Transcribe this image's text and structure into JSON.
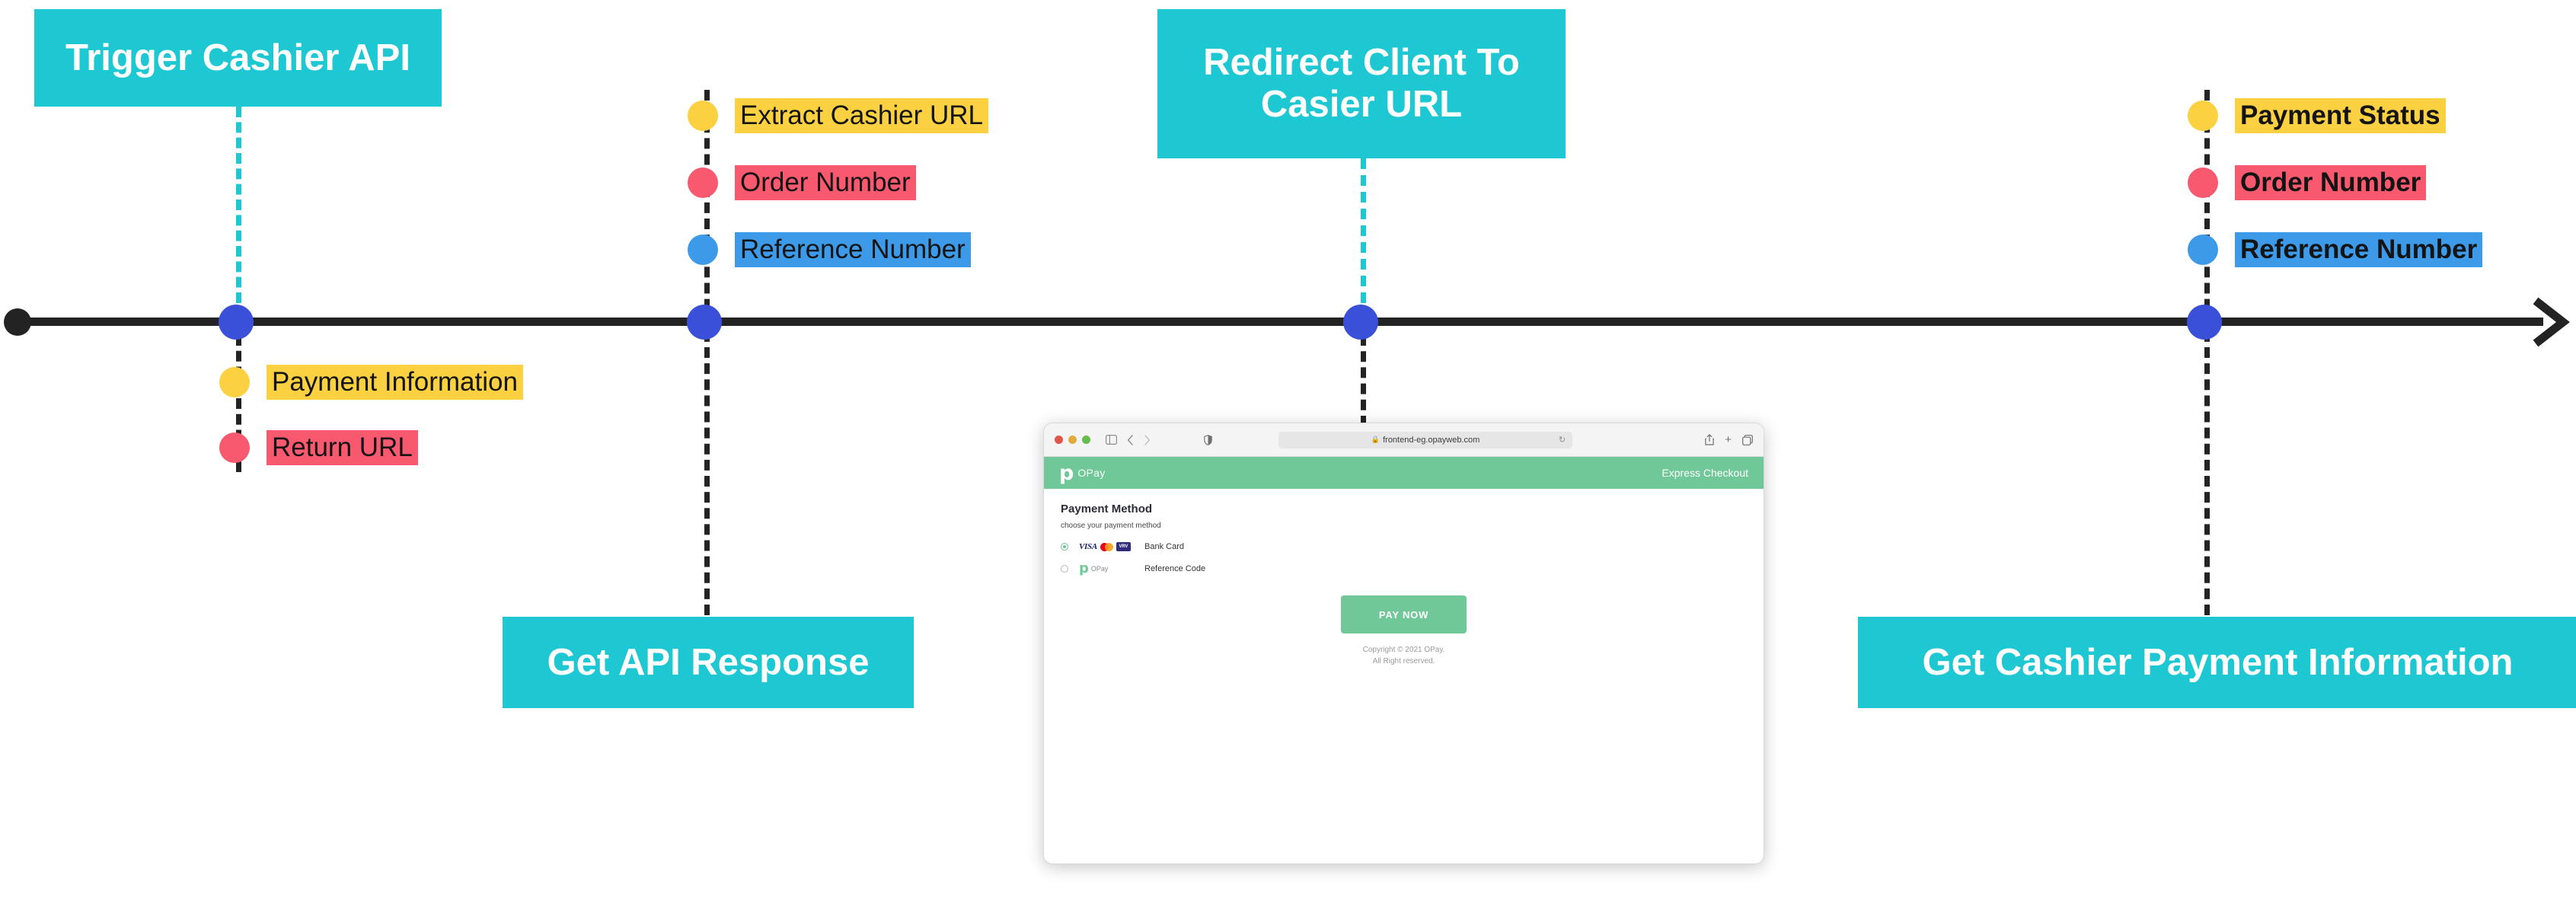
{
  "diagram": {
    "title": "OPay Cashier API integration timeline",
    "colors": {
      "teal": "#1ec8d3",
      "node_blue": "#3b50d8",
      "axis_black": "#232323",
      "yellow": "#fbd041",
      "pink": "#f8596f",
      "blue": "#3d9ae8",
      "opay_green": "#70c898"
    },
    "stages": [
      {
        "id": "trigger",
        "label": "Trigger Cashier API"
      },
      {
        "id": "api_response",
        "label": "Get API Response"
      },
      {
        "id": "redirect",
        "label": "Redirect Client To Casier URL"
      },
      {
        "id": "cashier_info",
        "label": "Get Cashier Payment Information"
      }
    ],
    "label_clusters": [
      {
        "id": "request-fields",
        "position": "below",
        "items": [
          {
            "text": "Payment Information",
            "color": "yellow",
            "bold": false
          },
          {
            "text": "Return URL",
            "color": "pink",
            "bold": false
          }
        ]
      },
      {
        "id": "response-fields",
        "position": "above",
        "items": [
          {
            "text": "Extract Cashier URL",
            "color": "yellow",
            "bold": false
          },
          {
            "text": "Order Number",
            "color": "pink",
            "bold": false
          },
          {
            "text": "Reference Number",
            "color": "blue",
            "bold": false
          }
        ]
      },
      {
        "id": "status-fields",
        "position": "above",
        "items": [
          {
            "text": "Payment Status",
            "color": "yellow",
            "bold": true
          },
          {
            "text": "Order Number",
            "color": "pink",
            "bold": true
          },
          {
            "text": "Reference Number",
            "color": "blue",
            "bold": true
          }
        ]
      }
    ]
  },
  "browser": {
    "url": "frontend-eg.opayweb.com",
    "lock_icon": "lock-icon",
    "reload_icon": "reload-icon",
    "traffic_lights": [
      "close-red",
      "minimize-yellow",
      "zoom-green"
    ],
    "toolbar_icons": [
      "sidebar-icon",
      "back-chevron-icon",
      "forward-chevron-icon",
      "shield-icon",
      "share-icon",
      "new-tab-icon",
      "tab-overview-icon"
    ],
    "page": {
      "brand_mark": "p",
      "brand_name": "OPay",
      "header_right": "Express Checkout",
      "section_title": "Payment Method",
      "section_subtitle": "choose your payment method",
      "methods": [
        {
          "id": "bank-card",
          "label": "Bank Card",
          "selected": true,
          "logos": [
            "VISA",
            "mastercard",
            "Verve"
          ]
        },
        {
          "id": "reference-code",
          "label": "Reference Code",
          "selected": false,
          "brand_mark": "p",
          "brand_name": "OPay"
        }
      ],
      "pay_button": "PAY NOW",
      "copyright_line1": "Copyright © 2021 OPay.",
      "copyright_line2": "All Right reserved."
    }
  }
}
